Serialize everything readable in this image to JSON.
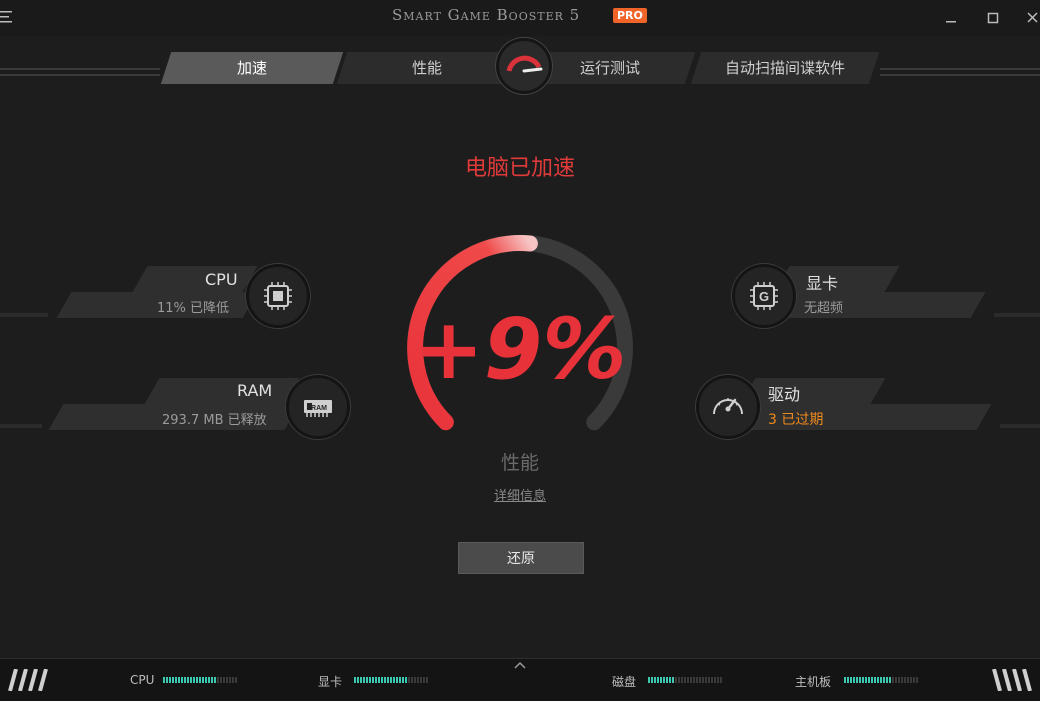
{
  "app": {
    "title": "Smart Game Booster 5",
    "badge": "PRO"
  },
  "tabs": [
    {
      "label": "加速",
      "active": true
    },
    {
      "label": "性能",
      "active": false
    },
    {
      "label": "运行测试",
      "active": false
    },
    {
      "label": "自动扫描间谍软件",
      "active": false
    }
  ],
  "status": {
    "title": "电脑已加速"
  },
  "left_items": [
    {
      "label": "CPU",
      "sub": "11% 已降低",
      "icon": "cpu-chip-icon"
    },
    {
      "label": "RAM",
      "sub": "293.7 MB 已释放",
      "icon": "ram-module-icon"
    }
  ],
  "right_items": [
    {
      "label": "显卡",
      "sub": "无超频",
      "icon": "gpu-chip-icon"
    },
    {
      "label": "驱动",
      "sub": "3 已过期",
      "icon": "speedometer-icon",
      "sub_color": "#f08a1c"
    }
  ],
  "gauge": {
    "value_text": "+9%",
    "fraction": 0.09,
    "label": "性能"
  },
  "links": {
    "details": "详细信息"
  },
  "buttons": {
    "restore": "还原"
  },
  "bottom_meters": [
    {
      "label": "CPU",
      "fill": 0.72
    },
    {
      "label": "显卡",
      "fill": 0.72
    },
    {
      "label": "磁盘",
      "fill": 0.34
    },
    {
      "label": "主机板",
      "fill": 0.64
    }
  ],
  "colors": {
    "accent_red": "#e03a3a",
    "warning_orange": "#f08a1c",
    "meter_teal": "#3cc9b0",
    "pro_badge": "#f0642a"
  }
}
